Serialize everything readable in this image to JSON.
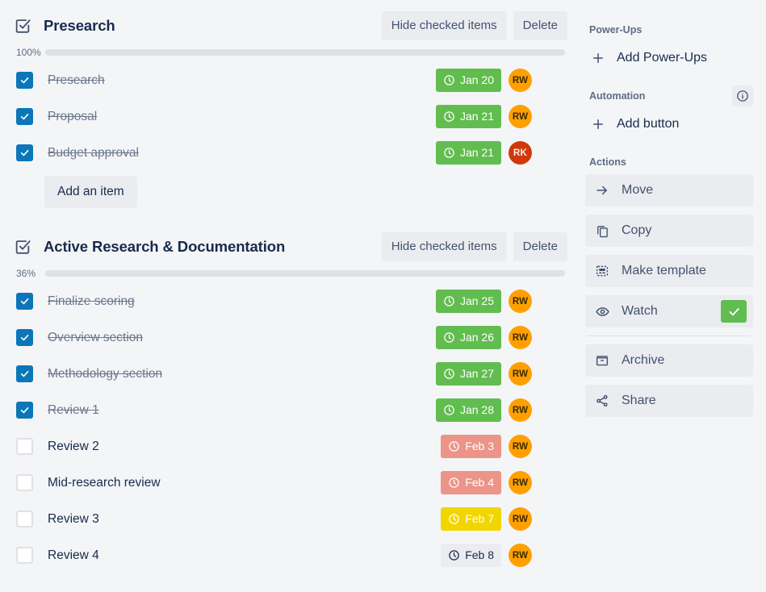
{
  "checklists": [
    {
      "title": "Presearch",
      "icon": "checklist-icon",
      "hide_checked_label": "Hide checked items",
      "delete_label": "Delete",
      "progress_percent_label": "100%",
      "progress_percent": 100,
      "progress_color": "#61BD4F",
      "add_item_label": "Add an item",
      "items": [
        {
          "label": "Presearch",
          "checked": true,
          "due": "Jan 20",
          "due_style": "green",
          "avatar": "RW",
          "avatar_style": "orange"
        },
        {
          "label": "Proposal",
          "checked": true,
          "due": "Jan 21",
          "due_style": "green",
          "avatar": "RW",
          "avatar_style": "orange"
        },
        {
          "label": "Budget approval",
          "checked": true,
          "due": "Jan 21",
          "due_style": "green",
          "avatar": "RK",
          "avatar_style": "red"
        }
      ]
    },
    {
      "title": "Active Research & Documentation",
      "icon": "checklist-icon",
      "hide_checked_label": "Hide checked items",
      "delete_label": "Delete",
      "progress_percent_label": "36%",
      "progress_percent": 36,
      "progress_color": "#5BA4CF",
      "items": [
        {
          "label": "Finalize scoring",
          "checked": true,
          "due": "Jan 25",
          "due_style": "green",
          "avatar": "RW",
          "avatar_style": "orange"
        },
        {
          "label": "Overview section",
          "checked": true,
          "due": "Jan 26",
          "due_style": "green",
          "avatar": "RW",
          "avatar_style": "orange"
        },
        {
          "label": "Methodology section",
          "checked": true,
          "due": "Jan 27",
          "due_style": "green",
          "avatar": "RW",
          "avatar_style": "orange"
        },
        {
          "label": "Review 1",
          "checked": true,
          "due": "Jan 28",
          "due_style": "green",
          "avatar": "RW",
          "avatar_style": "orange"
        },
        {
          "label": "Review 2",
          "checked": false,
          "due": "Feb 3",
          "due_style": "red",
          "avatar": "RW",
          "avatar_style": "orange"
        },
        {
          "label": "Mid-research review",
          "checked": false,
          "due": "Feb 4",
          "due_style": "red",
          "avatar": "RW",
          "avatar_style": "orange"
        },
        {
          "label": "Review 3",
          "checked": false,
          "due": "Feb 7",
          "due_style": "yellow",
          "avatar": "RW",
          "avatar_style": "orange"
        },
        {
          "label": "Review 4",
          "checked": false,
          "due": "Feb 8",
          "due_style": "grey",
          "avatar": "RW",
          "avatar_style": "orange"
        }
      ]
    }
  ],
  "sidebar": {
    "powerups": {
      "heading": "Power-Ups",
      "add_label": "Add Power-Ups"
    },
    "automation": {
      "heading": "Automation",
      "add_label": "Add button",
      "info_icon": "info-icon"
    },
    "actions": {
      "heading": "Actions",
      "items": [
        {
          "label": "Move",
          "icon": "arrow-right-icon"
        },
        {
          "label": "Copy",
          "icon": "copy-icon"
        },
        {
          "label": "Make template",
          "icon": "template-icon"
        },
        {
          "label": "Watch",
          "icon": "eye-icon",
          "watching": true
        },
        {
          "label": "Archive",
          "icon": "archive-icon"
        },
        {
          "label": "Share",
          "icon": "share-icon"
        }
      ]
    }
  },
  "colors": {
    "background": "#F4F5F7",
    "checkbox_checked": "#0B76B8",
    "due_green": "#61BD4F",
    "due_red": "#EC9488",
    "due_yellow": "#F2D600",
    "due_grey": "#EBECF0",
    "avatar_orange": "#FFA000",
    "avatar_red": "#CF3A0B",
    "progress_complete": "#61BD4F",
    "progress_partial": "#5BA4CF",
    "watch_toggle": "#61BD4F"
  }
}
